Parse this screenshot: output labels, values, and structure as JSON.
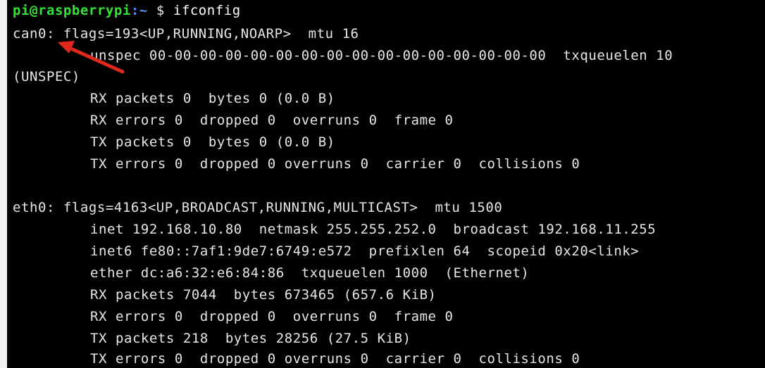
{
  "prompt": {
    "user_host": "pi@raspberrypi",
    "path": ":~",
    "symbol": "$",
    "command": "ifconfig"
  },
  "colors": {
    "background": "#000000",
    "text": "#e6e6e6",
    "prompt_user": "#34e234",
    "prompt_path": "#5f8ff2",
    "annotation_arrow": "#e0291e"
  },
  "annotation": {
    "icon": "red-arrow-icon"
  },
  "output": {
    "can0_header": "can0: flags=193<UP,RUNNING,NOARP>  mtu 16",
    "can0_unspec": "unspec 00-00-00-00-00-00-00-00-00-00-00-00-00-00-00-00  txqueuelen 10",
    "can0_unspec_wrap": "(UNSPEC)",
    "can0_rx_packets": "RX packets 0  bytes 0 (0.0 B)",
    "can0_rx_errors": "RX errors 0  dropped 0  overruns 0  frame 0",
    "can0_tx_packets": "TX packets 0  bytes 0 (0.0 B)",
    "can0_tx_errors": "TX errors 0  dropped 0 overruns 0  carrier 0  collisions 0",
    "eth0_header": "eth0: flags=4163<UP,BROADCAST,RUNNING,MULTICAST>  mtu 1500",
    "eth0_inet": "inet 192.168.10.80  netmask 255.255.252.0  broadcast 192.168.11.255",
    "eth0_inet6": "inet6 fe80::7af1:9de7:6749:e572  prefixlen 64  scopeid 0x20<link>",
    "eth0_ether": "ether dc:a6:32:e6:84:86  txqueuelen 1000  (Ethernet)",
    "eth0_rx_packets": "RX packets 7044  bytes 673465 (657.6 KiB)",
    "eth0_rx_errors": "RX errors 0  dropped 0  overruns 0  frame 0",
    "eth0_tx_packets": "TX packets 218  bytes 28256 (27.5 KiB)",
    "eth0_tx_errors": "TX errors 0  dropped 0 overruns 0  carrier 0  collisions 0"
  }
}
